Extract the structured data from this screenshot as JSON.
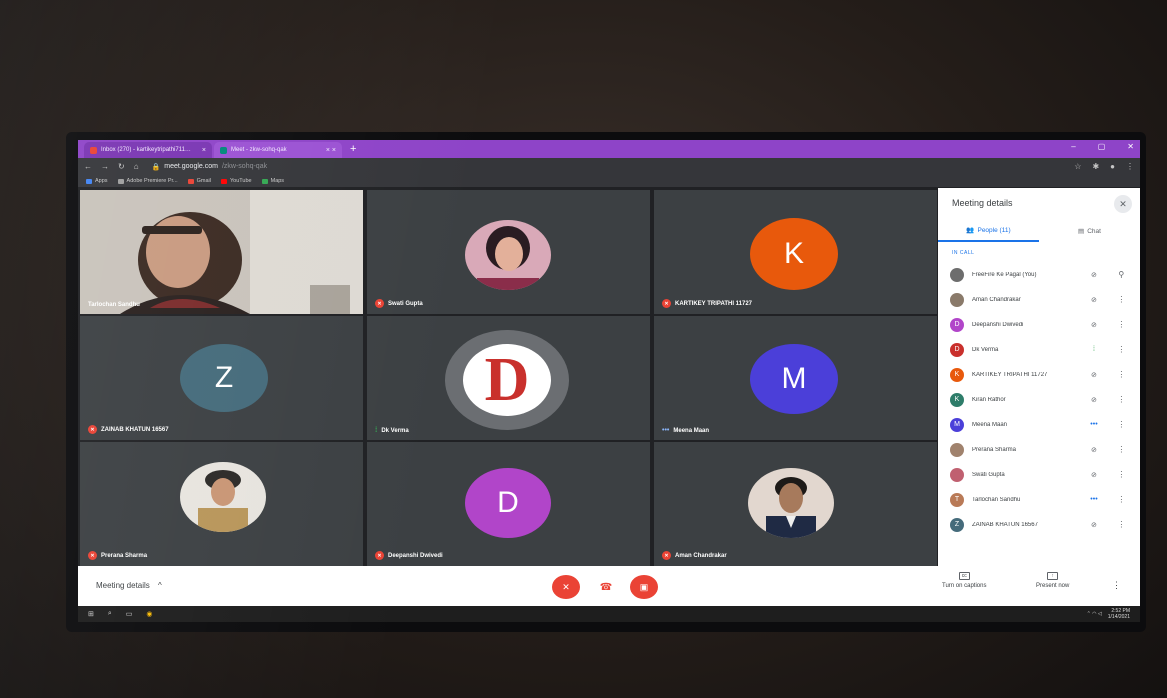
{
  "browser": {
    "tabs": [
      {
        "label": "Inbox (270) - kartikeytripathi711…",
        "close": "×"
      },
      {
        "label": "Meet - zkw-sohq-qak",
        "close": "× ×"
      }
    ],
    "new_tab": "+",
    "window_controls": [
      "–",
      "▢",
      "✕"
    ],
    "url_host": "meet.google.com",
    "url_path": "/zkw-sohq-qak",
    "bookmarks": [
      {
        "label": "Apps",
        "color": "#4285f4"
      },
      {
        "label": "Adobe Premiere Pr...",
        "color": "#9e9e9e"
      },
      {
        "label": "Gmail",
        "color": "#ea4335"
      },
      {
        "label": "YouTube",
        "color": "#ff0000"
      },
      {
        "label": "Maps",
        "color": "#34a853"
      }
    ]
  },
  "grid": {
    "tiles": [
      {
        "name": "Tarlochan Sandhu",
        "type": "video"
      },
      {
        "name": "Swati Gupta",
        "type": "photo",
        "status": "muted"
      },
      {
        "name": "KARTIKEY TRIPATHI 11727",
        "type": "initial",
        "initial": "K",
        "color": "#e8590c",
        "status": "muted"
      },
      {
        "name": "ZAINAB KHATUN 16567",
        "type": "initial",
        "initial": "Z",
        "color": "#456b7b",
        "status": "muted"
      },
      {
        "name": "Dk Verma",
        "type": "logo",
        "initial": "D",
        "status": "speaking"
      },
      {
        "name": "Meena Maan",
        "type": "initial",
        "initial": "M",
        "color": "#4b3fd9",
        "status": "connecting"
      },
      {
        "name": "Prerana Sharma",
        "type": "photo",
        "status": "muted"
      },
      {
        "name": "Deepanshi Dwivedi",
        "type": "initial",
        "initial": "D",
        "color": "#b145c9",
        "status": "muted"
      },
      {
        "name": "Aman Chandrakar",
        "type": "photo",
        "status": "muted"
      }
    ]
  },
  "bottombar": {
    "meeting_details": "Meeting details",
    "chevron": "^",
    "captions": "Turn on captions",
    "present": "Present now",
    "more": "⋮"
  },
  "panel": {
    "title": "Meeting details",
    "close": "✕",
    "people_tab": "People (11)",
    "chat_tab": "Chat",
    "in_call": "IN CALL",
    "participants": [
      {
        "name": "FreeFire Ke Pagal (You)",
        "initial": "",
        "color": "#6d6d6d",
        "mic": "mic-off",
        "action": "pin"
      },
      {
        "name": "Aman Chandrakar",
        "initial": "",
        "color": "#8a7a6a",
        "mic": "mic-off",
        "action": "more"
      },
      {
        "name": "Deepanshi Dwivedi",
        "initial": "D",
        "color": "#b145c9",
        "mic": "mic-off",
        "action": "more"
      },
      {
        "name": "Dk Verma",
        "initial": "D",
        "color": "#c9302c",
        "mic": "speaking",
        "action": "more"
      },
      {
        "name": "KARTIKEY TRIPATHI 11727",
        "initial": "K",
        "color": "#e8590c",
        "mic": "mic-off",
        "action": "more"
      },
      {
        "name": "Kiran Rathor",
        "initial": "K",
        "color": "#2e7d6a",
        "mic": "mic-off",
        "action": "more"
      },
      {
        "name": "Meena Maan",
        "initial": "M",
        "color": "#4b3fd9",
        "mic": "connecting",
        "action": "more"
      },
      {
        "name": "Prerana Sharma",
        "initial": "",
        "color": "#a0826d",
        "mic": "mic-off",
        "action": "more"
      },
      {
        "name": "Swati Gupta",
        "initial": "",
        "color": "#c06070",
        "mic": "mic-off",
        "action": "more"
      },
      {
        "name": "Tarlochan Sandhu",
        "initial": "T",
        "color": "#b97a57",
        "mic": "connecting",
        "action": "more"
      },
      {
        "name": "ZAINAB KHATUN 16567",
        "initial": "Z",
        "color": "#456b7b",
        "mic": "mic-off",
        "action": "more"
      }
    ]
  },
  "taskbar": {
    "time": "2:52 PM",
    "date": "1/14/2021"
  }
}
